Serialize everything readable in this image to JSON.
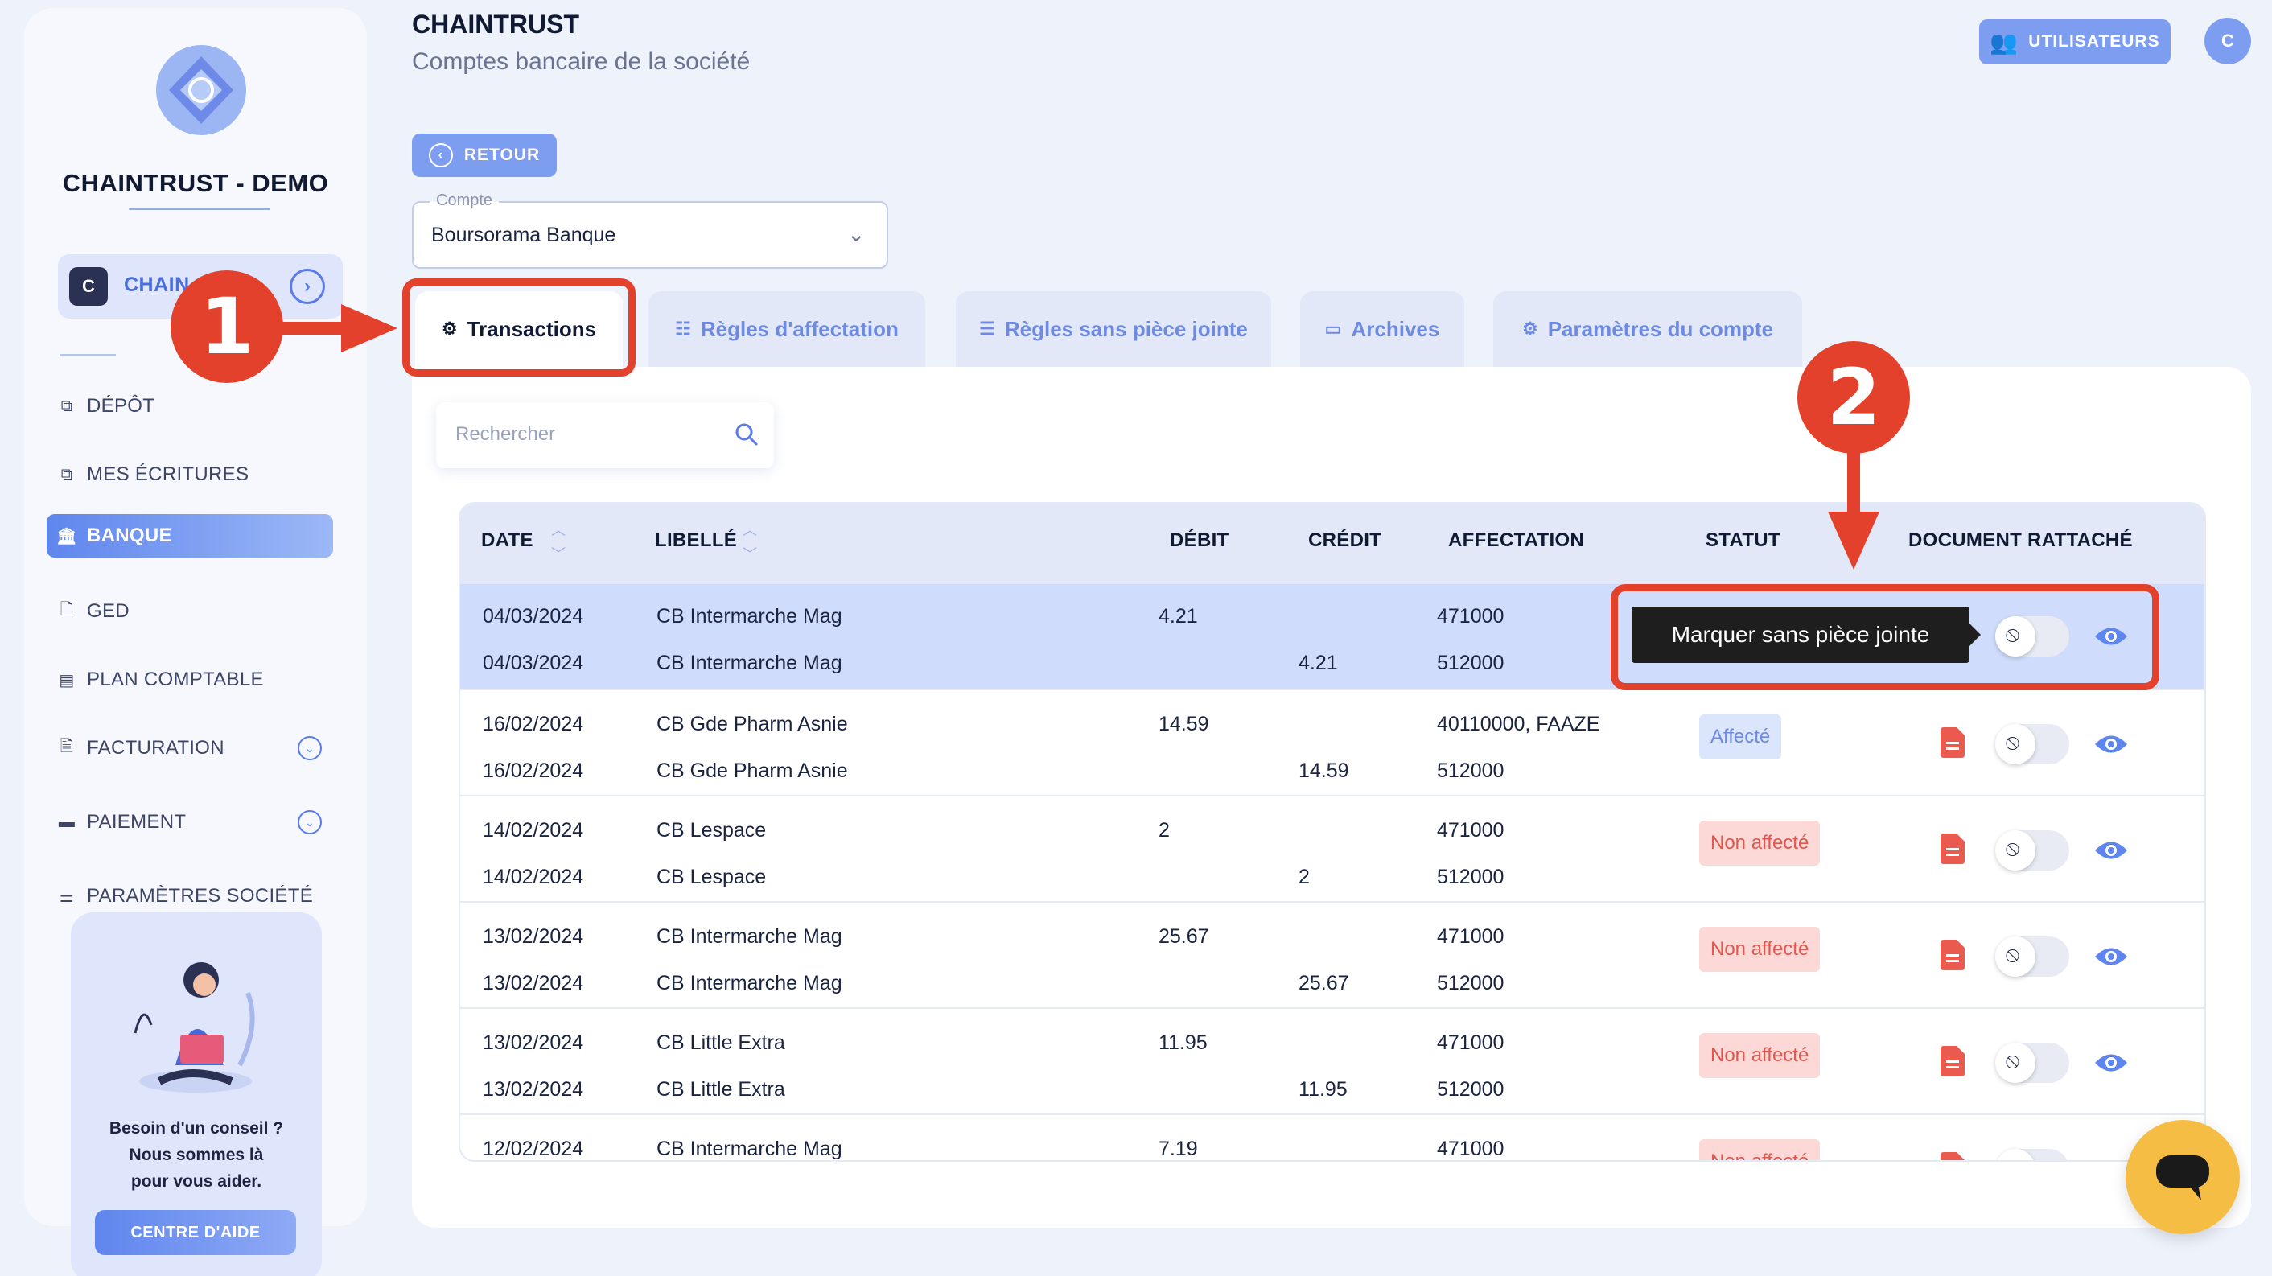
{
  "header": {
    "title": "CHAINTRUST",
    "subtitle": "Comptes bancaire de la société",
    "users_button": "UTILISATEURS",
    "avatar_initial": "C"
  },
  "sidebar": {
    "company": "CHAINTRUST - DEMO",
    "workspace_icon_letter": "C",
    "workspace_label": "CHAIN",
    "items": [
      {
        "label": "DÉPÔT",
        "icon": "upload-icon"
      },
      {
        "label": "MES ÉCRITURES",
        "icon": "upload-icon"
      },
      {
        "label": "BANQUE",
        "icon": "bank-icon",
        "active": true
      },
      {
        "label": "GED",
        "icon": "document-icon"
      },
      {
        "label": "PLAN COMPTABLE",
        "icon": "list-icon"
      },
      {
        "label": "FACTURATION",
        "icon": "invoice-icon"
      },
      {
        "label": "PAIEMENT",
        "icon": "card-icon"
      },
      {
        "label": "PARAMÈTRES SOCIÉTÉ",
        "icon": "sliders-icon"
      }
    ],
    "help": {
      "line1": "Besoin d'un conseil ?",
      "line2": "Nous sommes là",
      "line3": "pour vous aider.",
      "button": "CENTRE D'AIDE"
    }
  },
  "back_button": "RETOUR",
  "account_select": {
    "label": "Compte",
    "value": "Boursorama Banque"
  },
  "tabs": [
    {
      "label": "Transactions",
      "active": true
    },
    {
      "label": "Règles d'affectation"
    },
    {
      "label": "Règles sans pièce jointe"
    },
    {
      "label": "Archives"
    },
    {
      "label": "Paramètres du compte"
    }
  ],
  "search": {
    "placeholder": "Rechercher"
  },
  "table": {
    "columns": [
      "DATE",
      "LIBELLÉ",
      "DÉBIT",
      "CRÉDIT",
      "AFFECTATION",
      "STATUT",
      "DOCUMENT RATTACHÉ"
    ],
    "rows": [
      {
        "date1": "04/03/2024",
        "label1": "CB Intermarche Mag",
        "debit": "4.21",
        "aff1": "471000",
        "date2": "04/03/2024",
        "label2": "CB Intermarche Mag",
        "credit": "4.21",
        "aff2": "512000",
        "status": "",
        "selected": true
      },
      {
        "date1": "16/02/2024",
        "label1": "CB Gde Pharm Asnie",
        "debit": "14.59",
        "aff1": "40110000, FAAZE",
        "date2": "16/02/2024",
        "label2": "CB Gde Pharm Asnie",
        "credit": "14.59",
        "aff2": "512000",
        "status": "Affecté"
      },
      {
        "date1": "14/02/2024",
        "label1": "CB Lespace",
        "debit": "2",
        "aff1": "471000",
        "date2": "14/02/2024",
        "label2": "CB Lespace",
        "credit": "2",
        "aff2": "512000",
        "status": "Non affecté"
      },
      {
        "date1": "13/02/2024",
        "label1": "CB Intermarche Mag",
        "debit": "25.67",
        "aff1": "471000",
        "date2": "13/02/2024",
        "label2": "CB Intermarche Mag",
        "credit": "25.67",
        "aff2": "512000",
        "status": "Non affecté"
      },
      {
        "date1": "13/02/2024",
        "label1": "CB Little Extra",
        "debit": "11.95",
        "aff1": "471000",
        "date2": "13/02/2024",
        "label2": "CB Little Extra",
        "credit": "11.95",
        "aff2": "512000",
        "status": "Non affecté"
      },
      {
        "date1": "12/02/2024",
        "label1": "CB Intermarche Mag",
        "debit": "7.19",
        "aff1": "471000",
        "status": "Non affecté"
      }
    ]
  },
  "tooltip": "Marquer sans pièce jointe",
  "annotations": {
    "step1": "1",
    "step2": "2",
    "color": "#e3412b"
  },
  "colors": {
    "accent": "#5f86ee",
    "affected": "#6d8ae0",
    "not_affected": "#e0574f"
  }
}
